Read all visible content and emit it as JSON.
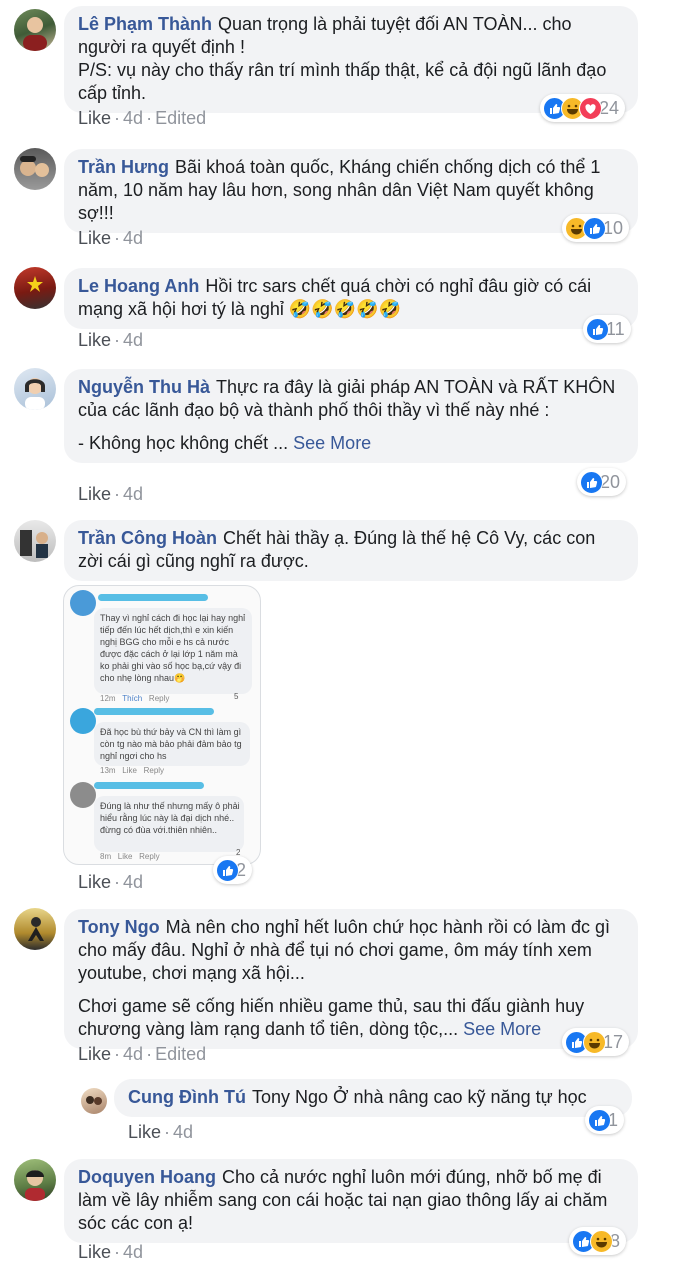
{
  "comments": [
    {
      "author": "Lê Phạm Thành",
      "paragraphs": [
        "Quan trọng là phải tuyệt đối AN TOÀN... cho người ra quyết định !",
        "P/S: vụ này cho thấy rân trí mình thấp thật, kể cả đội ngũ lãnh đạo cấp tỉnh."
      ],
      "like": "Like",
      "time": "4d",
      "edited": "Edited",
      "reactions": [
        "like",
        "haha",
        "love"
      ],
      "reaction_count": "24"
    },
    {
      "author": "Trần Hưng",
      "paragraphs": [
        "Bãi khoá toàn quốc, Kháng chiến chống dịch có thể 1 năm, 10 năm hay lâu hơn, song nhân dân Việt Nam quyết không sợ!!!"
      ],
      "like": "Like",
      "time": "4d",
      "reactions": [
        "haha",
        "like"
      ],
      "reaction_count": "10"
    },
    {
      "author": "Le Hoang Anh",
      "paragraphs": [
        "Hồi trc sars chết quá chời có nghỉ đâu giờ có cái mạng xã hội hơi tý là nghỉ 🤣🤣🤣🤣🤣"
      ],
      "like": "Like",
      "time": "4d",
      "reactions": [
        "like"
      ],
      "reaction_count": "11"
    },
    {
      "author": "Nguyễn Thu Hà",
      "paragraphs": [
        "Thực ra đây là giải pháp AN TOÀN và RẤT KHÔN của các lãnh đạo bộ và thành phố thôi thầy vì thế này nhé :",
        "- Không học không chết ..."
      ],
      "see_more": "See More",
      "like": "Like",
      "time": "4d",
      "reactions": [
        "like"
      ],
      "reaction_count": "20"
    },
    {
      "author": "Trần Công Hoàn",
      "paragraphs": [
        "Chết hài thầy ạ. Đúng là thế hệ Cô Vy, các con zời cái gì cũng nghĩ ra được."
      ],
      "like": "Like",
      "time": "4d",
      "reactions": [
        "like"
      ],
      "reaction_count": "2"
    },
    {
      "author": "Tony Ngo",
      "paragraphs": [
        "Mà nên cho nghỉ hết luôn chứ học hành rồi có làm đc gì cho mấy đâu. Nghỉ ở nhà để tụi nó chơi game, ôm máy tính xem youtube, chơi mạng xã hội...",
        "Chơi game sẽ cống hiến nhiều game thủ, sau thi đấu giành huy chương vàng làm rạng danh tổ tiên, dòng tộc,..."
      ],
      "see_more": "See More",
      "like": "Like",
      "time": "4d",
      "edited": "Edited",
      "reactions": [
        "like",
        "haha"
      ],
      "reaction_count": "17"
    },
    {
      "author": "Cung Đình Tú",
      "paragraphs": [
        "Tony Ngo Ở nhà nâng cao kỹ năng tự học"
      ],
      "like": "Like",
      "time": "4d",
      "reactions": [
        "like"
      ],
      "reaction_count": "1"
    },
    {
      "author": "Doquyen Hoang",
      "paragraphs": [
        "Cho cả nước nghỉ luôn mới đúng, nhỡ bố mẹ đi làm về lây nhiễm sang con cái hoặc tai nạn giao thông lấy ai chăm sóc các con ạ!"
      ],
      "like": "Like",
      "time": "4d",
      "reactions": [
        "like",
        "haha"
      ],
      "reaction_count": "8"
    }
  ],
  "attachment": {
    "messages": [
      {
        "text": "Thay vì nghỉ cách đi học lại hay nghỉ tiếp đến lúc hết dịch,thì e xin kiến nghị BGG cho mỗi e hs cả nước được đặc cách ở lại lớp 1 năm mà ko phải ghi vào số học bạ,cứ vậy đi cho nhẹ lòng nhau🤭",
        "time": "12m",
        "like": "Thích",
        "reply": "Reply",
        "count": "5"
      },
      {
        "text": "Đã học bù thứ bảy và CN thì làm gì còn tg nào mà bảo phải đảm bảo tg nghỉ ngơi cho hs",
        "time": "13m",
        "like": "Like",
        "reply": "Reply"
      },
      {
        "text": "Đúng là như thế nhưng mấy ô phải hiểu rằng lúc này là đại dịch nhé.. đừng có đùa với.thiên nhiên..",
        "time": "8m",
        "like": "Like",
        "reply": "Reply",
        "count": "2"
      }
    ]
  },
  "colors": {
    "author": "#385898",
    "bubble": "#f2f3f5",
    "meta": "#90949c",
    "like_reaction": "#1877f2",
    "haha_reaction": "#f7b928",
    "love_reaction": "#f33e58"
  }
}
